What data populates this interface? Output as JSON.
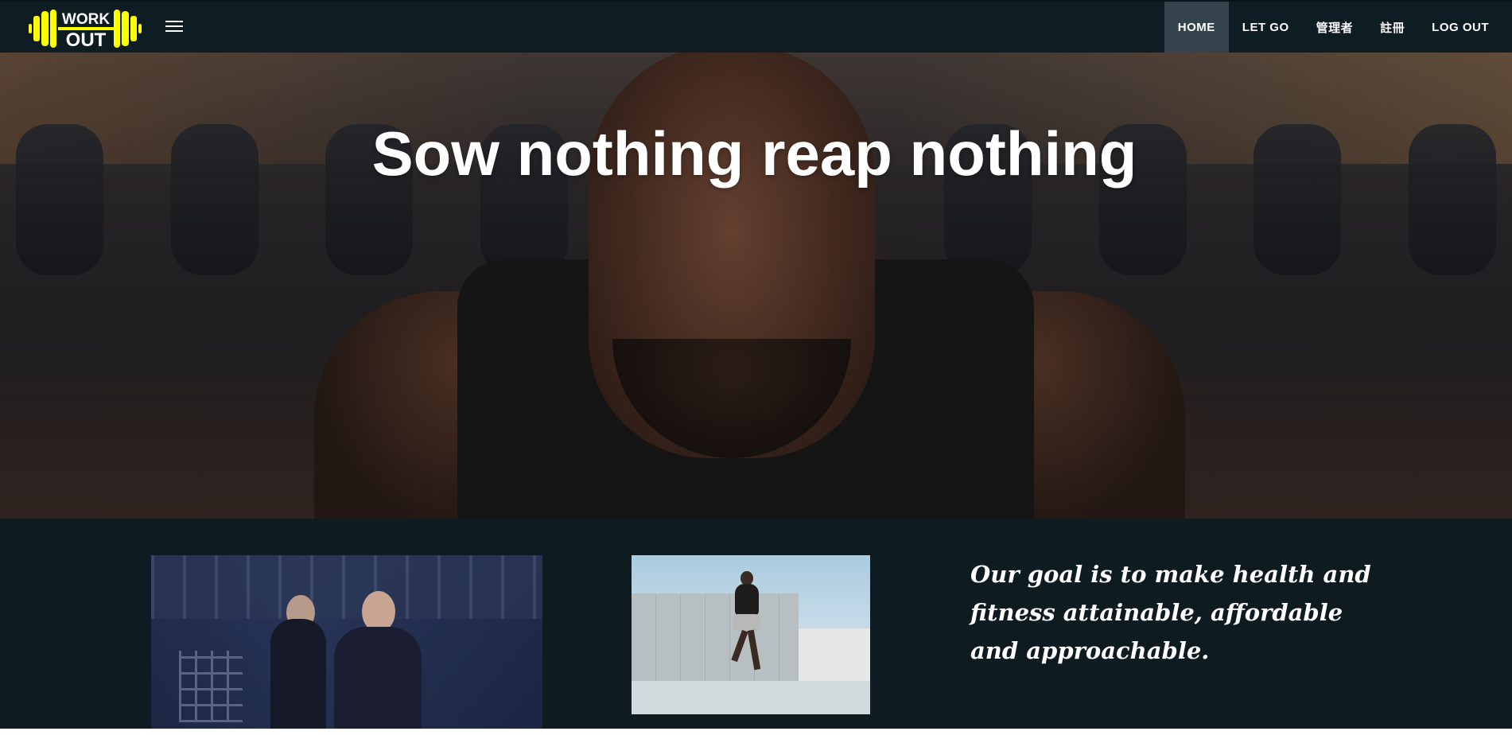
{
  "brand": {
    "logo_line1": "WORK",
    "logo_line2": "OUT",
    "logo_color": "#ffff00"
  },
  "nav": {
    "menu_icon": "hamburger-icon",
    "links": [
      {
        "label": "HOME",
        "active": true
      },
      {
        "label": "LET GO",
        "active": false
      },
      {
        "label": "管理者",
        "active": false
      },
      {
        "label": "註冊",
        "active": false
      },
      {
        "label": "LOG OUT",
        "active": false
      }
    ]
  },
  "hero": {
    "title": "Sow nothing reap nothing"
  },
  "about": {
    "goal_text": "Our goal is to make health and fitness attainable, affordable and approachable."
  },
  "colors": {
    "nav_bg": "#0e1c24",
    "nav_active_bg": "#34434c",
    "section_bg": "#0e1c22"
  }
}
